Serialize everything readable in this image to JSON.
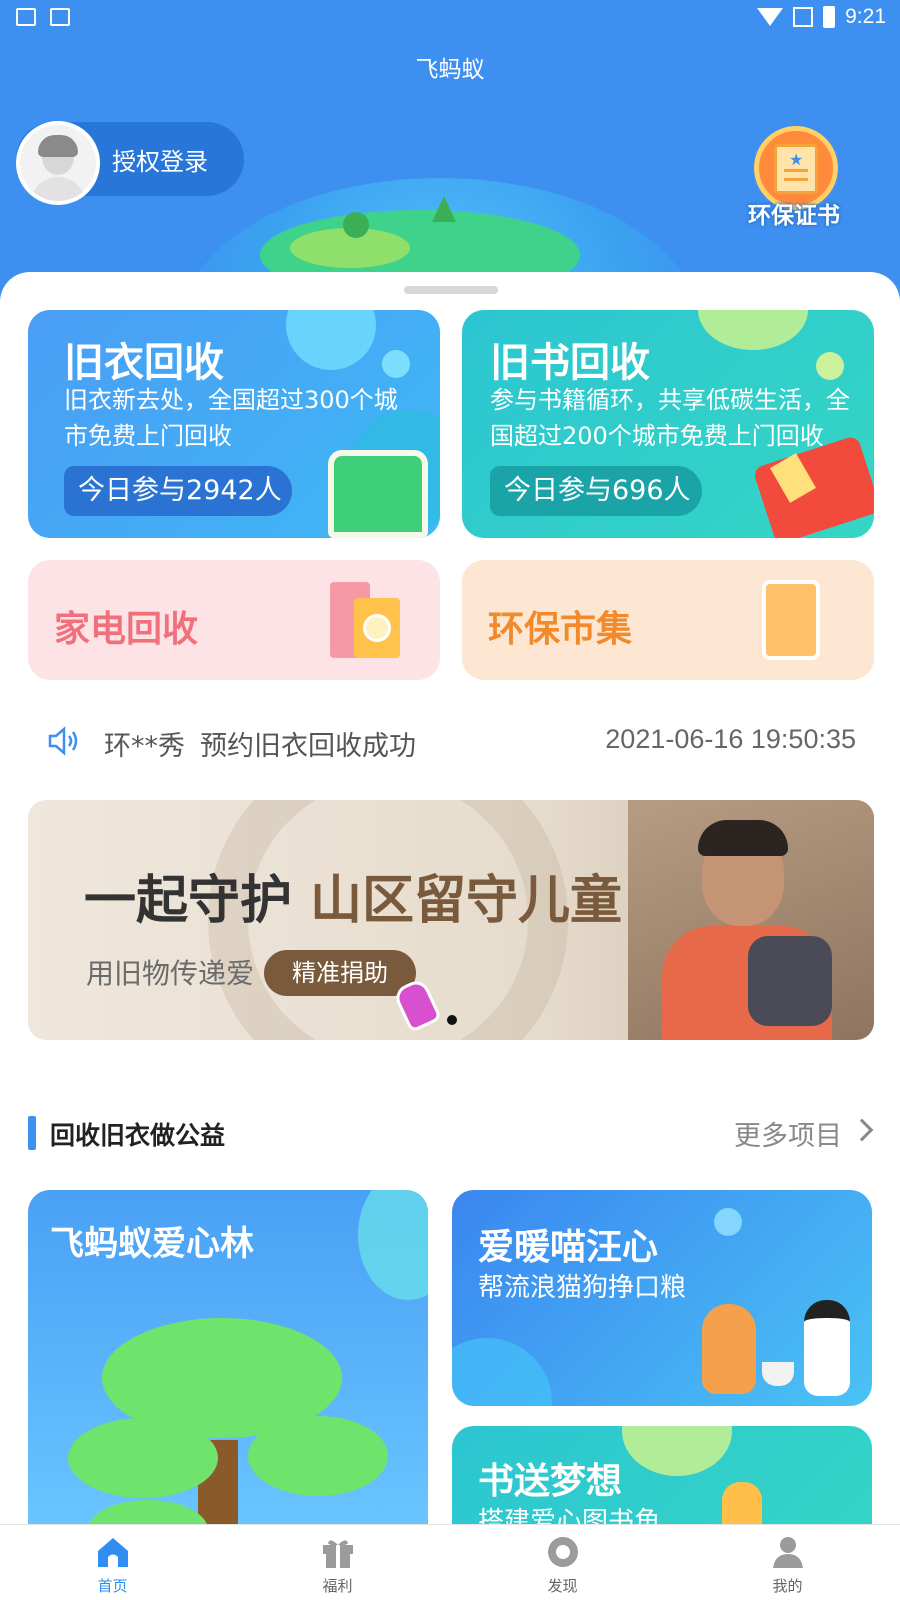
{
  "status_bar": {
    "time": "9:21"
  },
  "header": {
    "app_title": "飞蚂蚁",
    "login_label": "授权登录",
    "certificate_label": "环保证书"
  },
  "cards": {
    "clothes": {
      "title": "旧衣回收",
      "desc_line1": "旧衣新去处，全国超过300个城",
      "desc_line2": "市免费上门回收",
      "today": "今日参与2942人"
    },
    "books": {
      "title": "旧书回收",
      "desc_line1": "参与书籍循环，共享低碳生活，全",
      "desc_line2": "国超过200个城市免费上门回收",
      "today": "今日参与696人"
    },
    "appliances": {
      "title": "家电回收"
    },
    "market": {
      "title": "环保市集"
    }
  },
  "notice": {
    "user": "环**秀",
    "message": "预约旧衣回收成功",
    "time": "2021-06-16 19:50:35"
  },
  "banner": {
    "title_a": "一起守护",
    "title_b": "山区留守儿童",
    "subtitle": "用旧物传递爱",
    "button": "精准捐助"
  },
  "section": {
    "title": "回收旧衣做公益",
    "more": "更多项目"
  },
  "projects": {
    "forest": {
      "title": "飞蚂蚁爱心林"
    },
    "pets": {
      "title": "爱暖喵汪心",
      "desc": "帮流浪猫狗挣口粮"
    },
    "dream": {
      "title": "书送梦想",
      "desc": "搭建爱心图书角"
    }
  },
  "nav": [
    {
      "label": "首页",
      "icon": "home-icon",
      "active": true
    },
    {
      "label": "福利",
      "icon": "gift-icon",
      "active": false
    },
    {
      "label": "发现",
      "icon": "discover-icon",
      "active": false
    },
    {
      "label": "我的",
      "icon": "user-icon",
      "active": false
    }
  ],
  "colors": {
    "primary": "#3d8ff0",
    "teal": "#2cc5d2",
    "pink_bg": "#fde3e6",
    "orange_bg": "#fee7d2"
  }
}
